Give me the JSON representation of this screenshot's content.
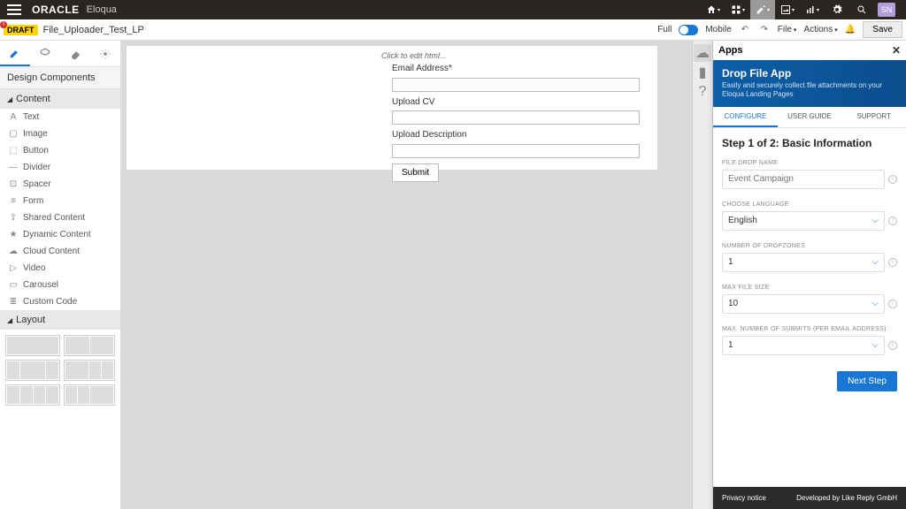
{
  "topnav": {
    "brand": "ORACLE",
    "product": "Eloqua",
    "user_initials": "SN"
  },
  "toolbar": {
    "draft_label": "DRAFT",
    "page_name": "File_Uploader_Test_LP",
    "full_label": "Full",
    "mobile_label": "Mobile",
    "file_label": "File",
    "actions_label": "Actions",
    "save_label": "Save"
  },
  "sidebar": {
    "title": "Design Components",
    "content_header": "Content",
    "layout_header": "Layout",
    "items": [
      {
        "icon": "A",
        "label": "Text"
      },
      {
        "icon": "▢",
        "label": "Image"
      },
      {
        "icon": "⬚",
        "label": "Button"
      },
      {
        "icon": "—",
        "label": "Divider"
      },
      {
        "icon": "⊡",
        "label": "Spacer"
      },
      {
        "icon": "≡",
        "label": "Form"
      },
      {
        "icon": "⇪",
        "label": "Shared Content"
      },
      {
        "icon": "★",
        "label": "Dynamic Content"
      },
      {
        "icon": "☁",
        "label": "Cloud Content"
      },
      {
        "icon": "▷",
        "label": "Video"
      },
      {
        "icon": "▭",
        "label": "Carousel"
      },
      {
        "icon": "≣",
        "label": "Custom Code"
      }
    ]
  },
  "canvas": {
    "edit_hint": "Click to edit html...",
    "fields": {
      "email_label": "Email Address*",
      "cv_label": "Upload CV",
      "desc_label": "Upload Description",
      "submit_label": "Submit"
    }
  },
  "apps": {
    "title": "Apps",
    "banner_title": "Drop File App",
    "banner_sub": "Easily and securely collect file attachments on your Eloqua Landing Pages",
    "tabs": {
      "configure": "CONFIGURE",
      "guide": "USER GUIDE",
      "support": "SUPPORT"
    },
    "step_title": "Step 1 of 2: Basic Information",
    "fields": {
      "name_label": "FILE DROP NAME",
      "name_placeholder": "Event Campaign",
      "lang_label": "CHOOSE LANGUAGE",
      "lang_value": "English",
      "zones_label": "NUMBER OF DROPZONES",
      "zones_value": "1",
      "max_label": "MAX FILE SIZE",
      "max_value": "10",
      "submits_label": "MAX. NUMBER OF SUBMITS (PER EMAIL ADDRESS)",
      "submits_value": "1"
    },
    "next_label": "Next Step",
    "footer": {
      "privacy": "Privacy notice",
      "dev": "Developed by Like Reply GmbH"
    }
  }
}
